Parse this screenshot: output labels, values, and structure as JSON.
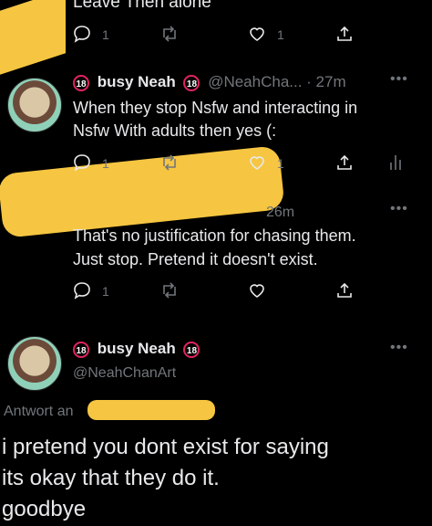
{
  "tweets": {
    "top": {
      "text": "Leave Then alone",
      "reply_count": "1",
      "like_count": "1"
    },
    "neah_reply": {
      "name": "busy Neah",
      "handle": "@NeahCha... · 27m",
      "badge": "18",
      "text_line1": "When they stop Nsfw and interacting in",
      "text_line2": "Nsfw With adults then yes (:",
      "reply_count": "1",
      "like_count": "1"
    },
    "other_reply": {
      "time": "26m",
      "text_line1": "That's no justification for chasing them.",
      "text_line2": "Just stop. Pretend it doesn't exist.",
      "reply_count": "1"
    },
    "main": {
      "name": "busy Neah",
      "handle": "@NeahChanArt",
      "badge": "18",
      "reply_to_label": "Antwort an",
      "text_line1": "i pretend you dont exist for saying",
      "text_line2": "its okay that they do it.",
      "text_line3": "goodbye"
    }
  },
  "colors": {
    "redaction": "#f6c541",
    "background": "#000000",
    "text": "#e7e9ea",
    "muted": "#71767b",
    "badge_red": "#e0245e"
  }
}
